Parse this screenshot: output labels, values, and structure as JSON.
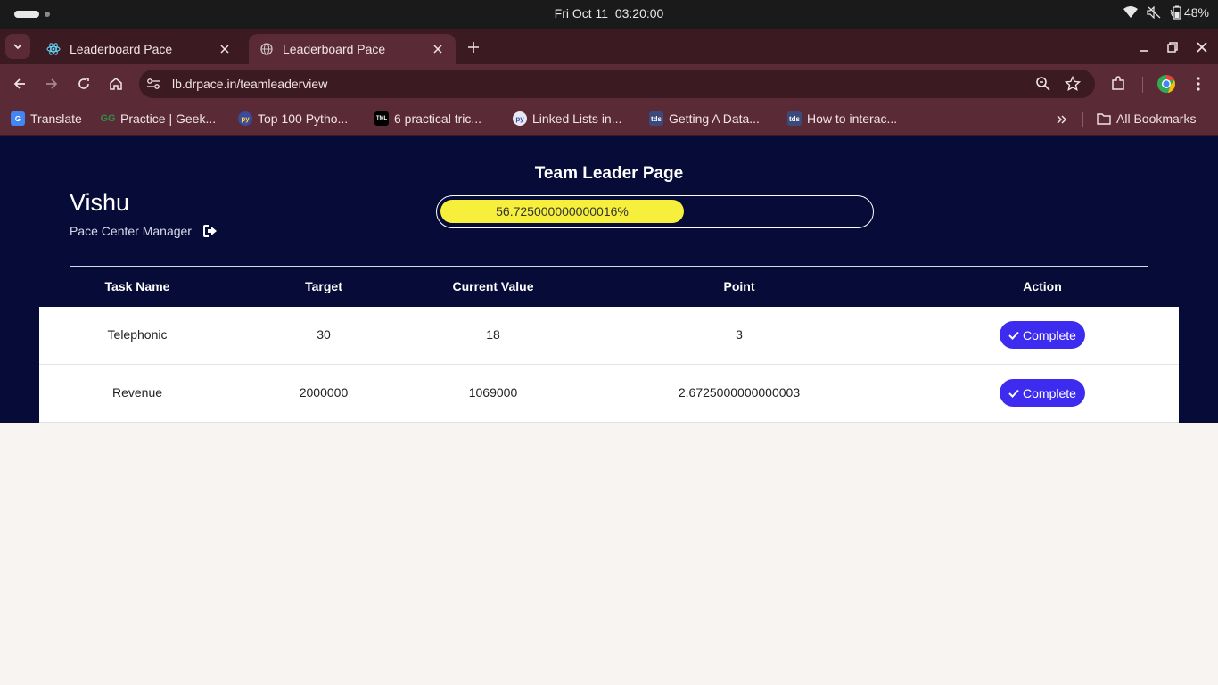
{
  "os": {
    "clock": "Fri Oct 11  03:20:00",
    "battery": "48%"
  },
  "browser": {
    "tabs": [
      {
        "title": "Leaderboard Pace",
        "icon": "react-icon",
        "active": false
      },
      {
        "title": "Leaderboard Pace",
        "icon": "globe-icon",
        "active": true
      }
    ],
    "url": "lb.drpace.in/teamleaderview",
    "bookmarks": [
      {
        "label": "Translate",
        "icon": "google-translate-icon"
      },
      {
        "label": "Practice | Geek...",
        "icon": "geeksforgeeks-icon"
      },
      {
        "label": "Top 100 Pytho...",
        "icon": "python-icon"
      },
      {
        "label": "6 practical tric...",
        "icon": "site-icon"
      },
      {
        "label": "Linked Lists in...",
        "icon": "python-icon"
      },
      {
        "label": "Getting A Data...",
        "icon": "tds-icon"
      },
      {
        "label": "How to interac...",
        "icon": "tds-icon"
      }
    ],
    "all_bookmarks": "All Bookmarks"
  },
  "page": {
    "title": "Team Leader Page",
    "user": {
      "name": "Vishu",
      "role": "Pace Center Manager"
    },
    "progress": {
      "label": "56.725000000000016%",
      "value": 56.725
    },
    "table": {
      "headers": [
        "Task Name",
        "Target",
        "Current Value",
        "Point",
        "Action"
      ],
      "rows": [
        {
          "task": "Telephonic",
          "target": "30",
          "current": "18",
          "point": "3",
          "action": "Complete"
        },
        {
          "task": "Revenue",
          "target": "2000000",
          "current": "1069000",
          "point": "2.6725000000000003",
          "action": "Complete"
        }
      ]
    }
  },
  "colors": {
    "header_bg": "#060b37",
    "progress_fill": "#f6ef3b",
    "button_bg": "#3d2bf0",
    "browser_frame": "#5a2b36"
  }
}
